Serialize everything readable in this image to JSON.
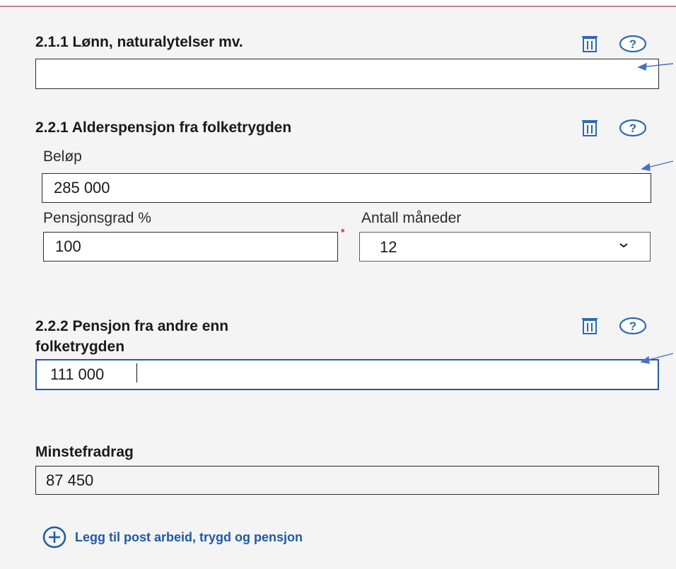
{
  "sections": {
    "lonn": {
      "heading": "2.1.1 Lønn, naturalytelser mv.",
      "value": ""
    },
    "alderspensjon": {
      "heading": "2.2.1 Alderspensjon fra folketrygden",
      "belop_label": "Beløp",
      "belop_value": "285 000",
      "pensjonsgrad_label": "Pensjonsgrad %",
      "pensjonsgrad_value": "100",
      "required_marker": "*",
      "maneder_label": "Antall måneder",
      "maneder_value": "12"
    },
    "annen_pensjon": {
      "heading_line1": "2.2.2 Pensjon fra andre enn",
      "heading_line2": "folketrygden",
      "value": "111 000"
    },
    "minstefradrag": {
      "heading": "Minstefradrag",
      "value": "87 450"
    }
  },
  "add_link": {
    "label": "Legg til post arbeid, trygd og pensjon"
  },
  "icons": {
    "delete": "trash-icon",
    "help": "help-icon",
    "add": "plus-circle-icon",
    "dropdown": "chevron-down-icon"
  },
  "colors": {
    "accent": "#1f5aa6",
    "icon": "#2a6ab0",
    "background": "#f4f4f4",
    "required": "#c0392b",
    "annotation_arrow": "#4472c4"
  }
}
